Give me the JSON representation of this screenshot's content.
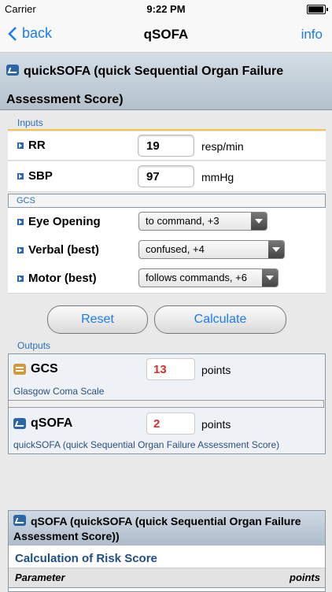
{
  "status": {
    "carrier": "Carrier",
    "time": "9:22 PM"
  },
  "nav": {
    "back": "back",
    "title": "qSOFA",
    "info": "info"
  },
  "header": {
    "title": "quickSOFA (quick Sequential Organ Failure Assessment Score)"
  },
  "inputs": {
    "section_label": "Inputs",
    "rr": {
      "label": "RR",
      "value": "19",
      "unit": "resp/min"
    },
    "sbp": {
      "label": "SBP",
      "value": "97",
      "unit": "mmHg"
    },
    "gcs_label": "GCS",
    "eye": {
      "label": "Eye Opening",
      "selected": "to command, +3"
    },
    "verbal": {
      "label": "Verbal (best)",
      "selected": "confused, +4"
    },
    "motor": {
      "label": "Motor (best)",
      "selected": "follows commands, +6"
    }
  },
  "buttons": {
    "reset": "Reset",
    "calculate": "Calculate"
  },
  "outputs": {
    "section_label": "Outputs",
    "gcs": {
      "label": "GCS",
      "value": "13",
      "unit": "points",
      "description": "Glasgow Coma Scale"
    },
    "qsofa": {
      "label": "qSOFA",
      "value": "2",
      "unit": "points",
      "description": "quickSOFA (quick Sequential Organ Failure Assessment Score)"
    }
  },
  "detail": {
    "title": "qSOFA (quickSOFA (quick Sequential Organ Failure Assessment Score))",
    "subtitle": "Calculation of Risk Score",
    "col_parameter": "Parameter",
    "col_points": "points"
  },
  "colors": {
    "accent": "#1a7cf5",
    "result": "#d32f2f",
    "section": "#2a6fb5"
  }
}
